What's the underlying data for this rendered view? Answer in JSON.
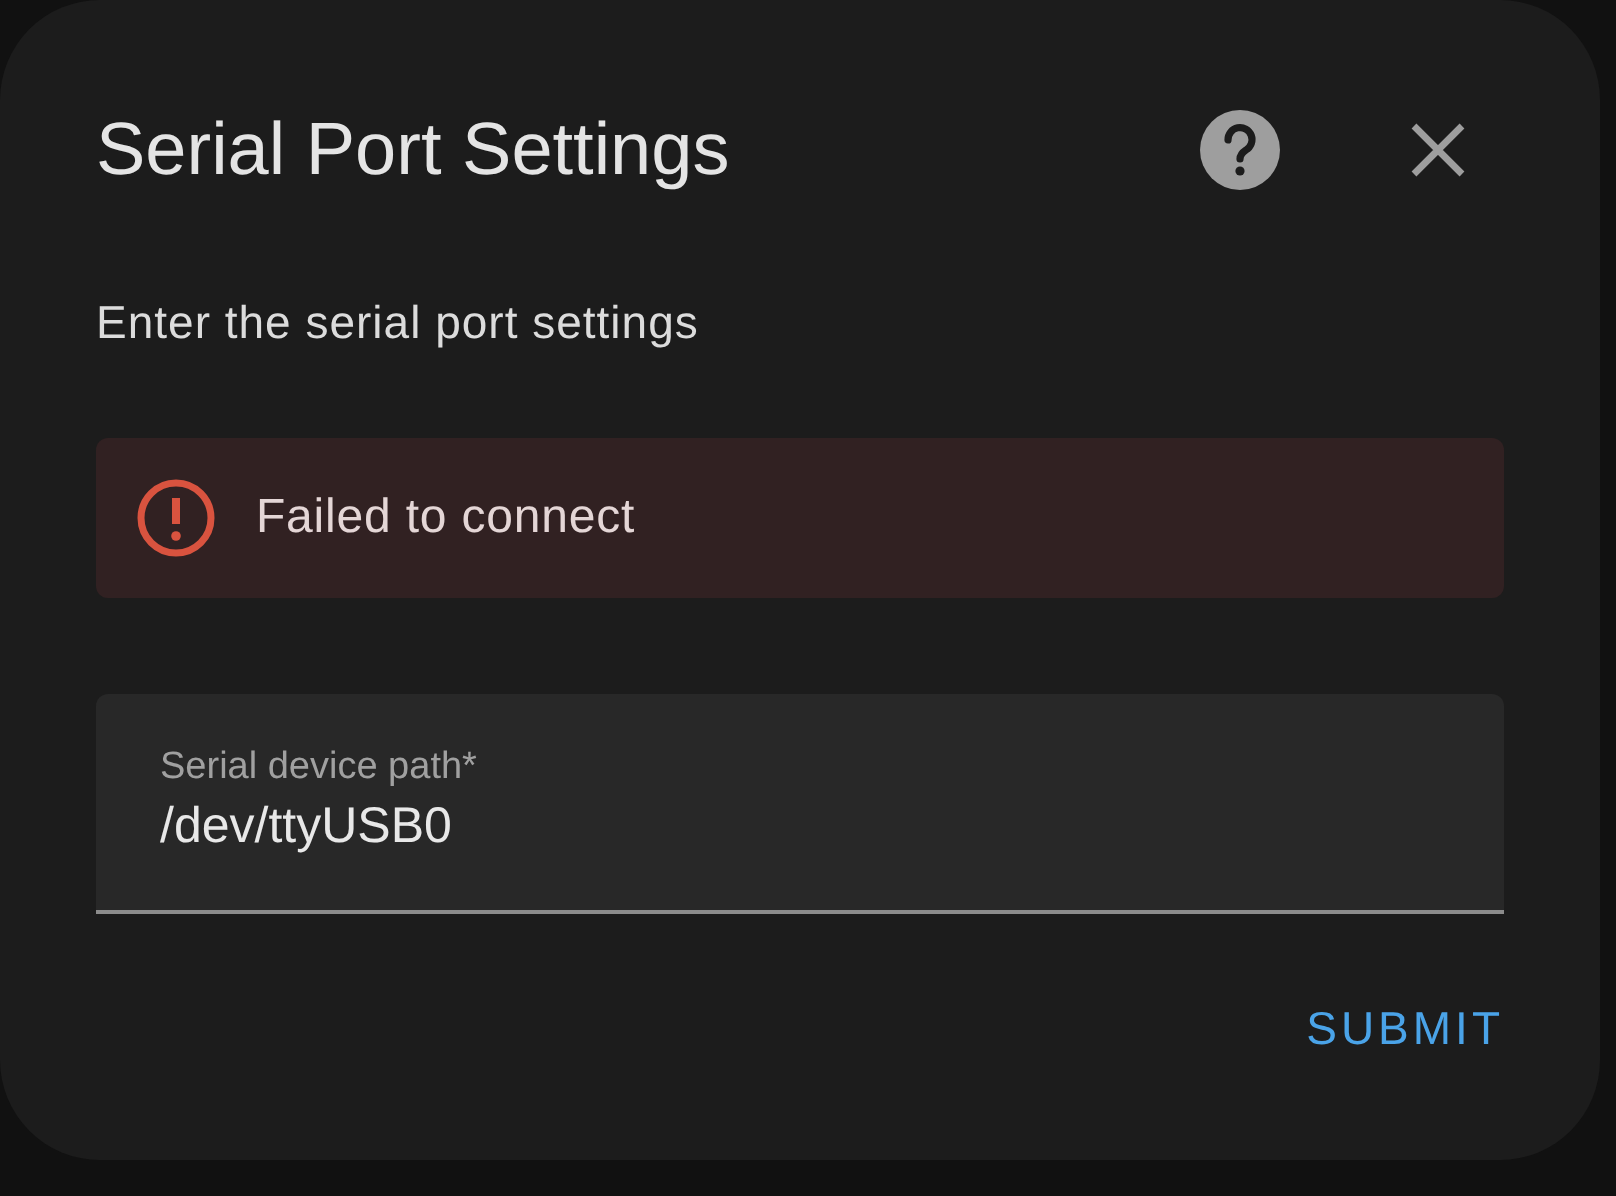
{
  "dialog": {
    "title": "Serial Port Settings",
    "description": "Enter the serial port settings"
  },
  "alert": {
    "kind": "error",
    "message": "Failed to connect"
  },
  "field": {
    "label": "Serial device path*",
    "value": "/dev/ttyUSB0"
  },
  "buttons": [
    {
      "label": "SUBMIT"
    }
  ]
}
